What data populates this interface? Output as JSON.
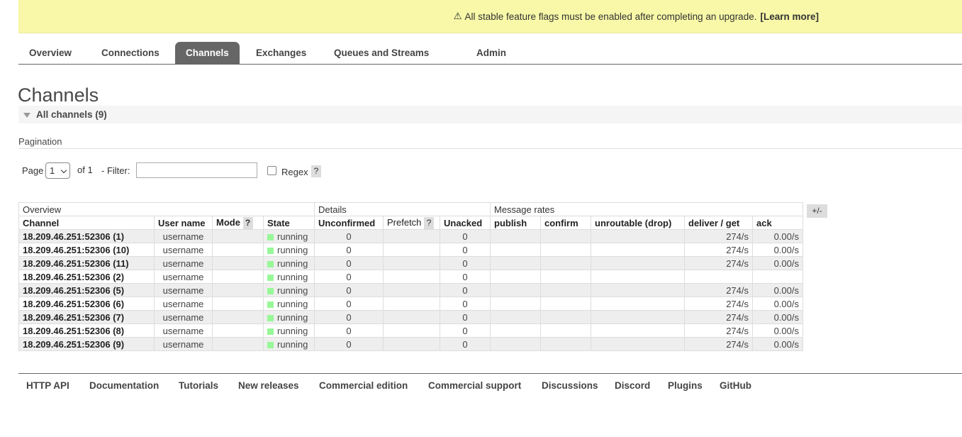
{
  "banner": {
    "icon": "warning-icon",
    "icon_glyph": "⚠",
    "text": "All stable feature flags must be enabled after completing an upgrade.",
    "link": "[Learn more]"
  },
  "tabs": [
    {
      "label": "Overview"
    },
    {
      "label": "Connections"
    },
    {
      "label": "Channels",
      "active": true
    },
    {
      "label": "Exchanges"
    },
    {
      "label": "Queues and Streams"
    },
    {
      "label": "Admin"
    }
  ],
  "page_title": "Channels",
  "section": {
    "label": "All channels (9)"
  },
  "pagination": {
    "title": "Pagination",
    "page_label": "Page",
    "page_value": "1",
    "of_label": "of 1",
    "filter_label": "- Filter:",
    "filter_value": "",
    "regex_label": "Regex",
    "regex_checked": false,
    "help": "?"
  },
  "table": {
    "groups": [
      "Overview",
      "Details",
      "Message rates"
    ],
    "columns": [
      "Channel",
      "User name",
      "Mode",
      "State",
      "Unconfirmed",
      "Prefetch",
      "Unacked",
      "publish",
      "confirm",
      "unroutable (drop)",
      "deliver / get",
      "ack"
    ],
    "help": "?",
    "plus_minus": "+/-",
    "state_color": "#98f898",
    "rows": [
      {
        "channel": "18.209.46.251:52306 (1)",
        "user": "username",
        "mode": "",
        "state": "running",
        "unconfirmed": "0",
        "prefetch": "",
        "unacked": "0",
        "publish": "",
        "confirm": "",
        "unroutable": "",
        "deliver": "274/s",
        "ack": "0.00/s"
      },
      {
        "channel": "18.209.46.251:52306 (10)",
        "user": "username",
        "mode": "",
        "state": "running",
        "unconfirmed": "0",
        "prefetch": "",
        "unacked": "0",
        "publish": "",
        "confirm": "",
        "unroutable": "",
        "deliver": "274/s",
        "ack": "0.00/s"
      },
      {
        "channel": "18.209.46.251:52306 (11)",
        "user": "username",
        "mode": "",
        "state": "running",
        "unconfirmed": "0",
        "prefetch": "",
        "unacked": "0",
        "publish": "",
        "confirm": "",
        "unroutable": "",
        "deliver": "274/s",
        "ack": "0.00/s"
      },
      {
        "channel": "18.209.46.251:52306 (2)",
        "user": "username",
        "mode": "",
        "state": "running",
        "unconfirmed": "0",
        "prefetch": "",
        "unacked": "0",
        "publish": "",
        "confirm": "",
        "unroutable": "",
        "deliver": "",
        "ack": ""
      },
      {
        "channel": "18.209.46.251:52306 (5)",
        "user": "username",
        "mode": "",
        "state": "running",
        "unconfirmed": "0",
        "prefetch": "",
        "unacked": "0",
        "publish": "",
        "confirm": "",
        "unroutable": "",
        "deliver": "274/s",
        "ack": "0.00/s"
      },
      {
        "channel": "18.209.46.251:52306 (6)",
        "user": "username",
        "mode": "",
        "state": "running",
        "unconfirmed": "0",
        "prefetch": "",
        "unacked": "0",
        "publish": "",
        "confirm": "",
        "unroutable": "",
        "deliver": "274/s",
        "ack": "0.00/s"
      },
      {
        "channel": "18.209.46.251:52306 (7)",
        "user": "username",
        "mode": "",
        "state": "running",
        "unconfirmed": "0",
        "prefetch": "",
        "unacked": "0",
        "publish": "",
        "confirm": "",
        "unroutable": "",
        "deliver": "274/s",
        "ack": "0.00/s"
      },
      {
        "channel": "18.209.46.251:52306 (8)",
        "user": "username",
        "mode": "",
        "state": "running",
        "unconfirmed": "0",
        "prefetch": "",
        "unacked": "0",
        "publish": "",
        "confirm": "",
        "unroutable": "",
        "deliver": "274/s",
        "ack": "0.00/s"
      },
      {
        "channel": "18.209.46.251:52306 (9)",
        "user": "username",
        "mode": "",
        "state": "running",
        "unconfirmed": "0",
        "prefetch": "",
        "unacked": "0",
        "publish": "",
        "confirm": "",
        "unroutable": "",
        "deliver": "274/s",
        "ack": "0.00/s"
      }
    ]
  },
  "footer": {
    "links": [
      "HTTP API",
      "Documentation",
      "Tutorials",
      "New releases",
      "Commercial edition",
      "Commercial support",
      "Discussions",
      "Discord",
      "Plugins",
      "GitHub"
    ]
  }
}
